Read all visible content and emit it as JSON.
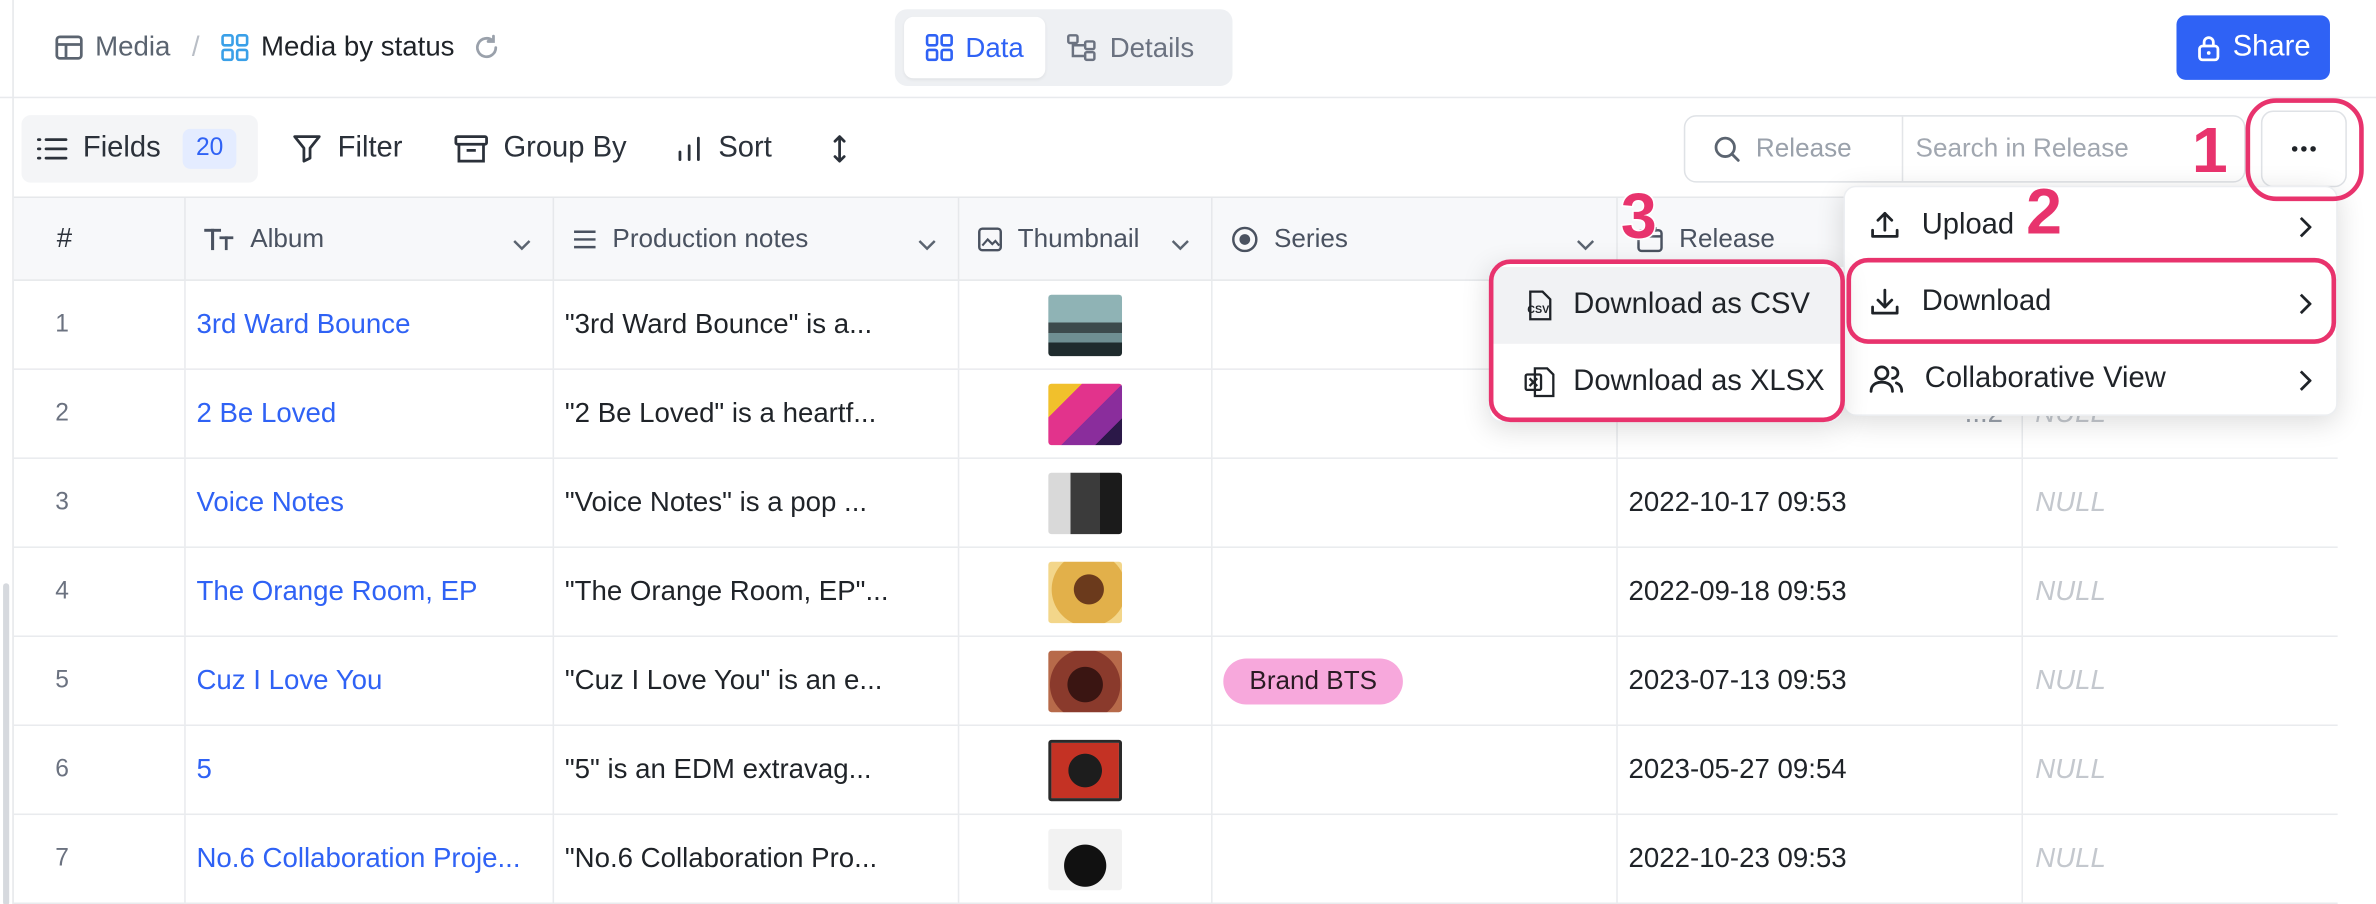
{
  "header": {
    "breadcrumb_root": "Media",
    "breadcrumb_separator": "/",
    "breadcrumb_current": "Media by status",
    "view_tabs": [
      {
        "label": "Data",
        "active": true
      },
      {
        "label": "Details",
        "active": false
      }
    ],
    "share_label": "Share"
  },
  "toolbar": {
    "fields_label": "Fields",
    "fields_count": "20",
    "filter_label": "Filter",
    "group_by_label": "Group By",
    "sort_label": "Sort",
    "search_field_label": "Release",
    "search_placeholder": "Search in Release"
  },
  "table": {
    "columns": [
      {
        "label": "#"
      },
      {
        "label": "Album",
        "icon": "text-type-icon"
      },
      {
        "label": "Production notes",
        "icon": "long-text-icon"
      },
      {
        "label": "Thumbnail",
        "icon": "image-icon"
      },
      {
        "label": "Series",
        "icon": "single-select-icon"
      },
      {
        "label": "Release",
        "icon": "calendar-icon"
      }
    ],
    "null_text": "NULL",
    "rows": [
      {
        "num": "1",
        "album": "3rd Ward Bounce",
        "notes": "\"3rd Ward Bounce\" is a...",
        "series": "",
        "release": "",
        "thumb_color": "#6c8a8e"
      },
      {
        "num": "2",
        "album": "2 Be Loved",
        "notes": "\"2 Be Loved\" is a heartf...",
        "series": "",
        "release": "",
        "thumb_color": "#d83f8a"
      },
      {
        "num": "3",
        "album": "Voice Notes",
        "notes": "\"Voice Notes\" is a pop ...",
        "series": "",
        "release": "2022-10-17 09:53",
        "thumb_color": "#3d3d3d"
      },
      {
        "num": "4",
        "album": "The Orange Room, EP",
        "notes": "\"The Orange Room, EP\"...",
        "series": "",
        "release": "2022-09-18 09:53",
        "thumb_color": "#d8a23a"
      },
      {
        "num": "5",
        "album": "Cuz I Love You",
        "notes": "\"Cuz I Love You\" is an e...",
        "series": "Brand BTS",
        "release": "2023-07-13 09:53",
        "thumb_color": "#7a2a26"
      },
      {
        "num": "6",
        "album": "5",
        "notes": "\"5\" is an EDM extravag...",
        "series": "",
        "release": "2023-05-27 09:54",
        "thumb_color": "#c43224"
      },
      {
        "num": "7",
        "album": "No.6 Collaboration Proje...",
        "notes": "\"No.6 Collaboration Pro...",
        "series": "",
        "release": "2022-10-23 09:53",
        "thumb_color": "#e9e9e9"
      }
    ],
    "hidden_release_fragment": "...2"
  },
  "more_menu": {
    "items": [
      {
        "label": "Upload",
        "icon": "upload-icon"
      },
      {
        "label": "Download",
        "icon": "download-icon"
      },
      {
        "label": "Collaborative View",
        "icon": "users-icon"
      }
    ]
  },
  "download_submenu": {
    "items": [
      {
        "label": "Download as CSV",
        "icon": "csv-file-icon"
      },
      {
        "label": "Download as XLSX",
        "icon": "xlsx-file-icon"
      }
    ]
  },
  "annotations": {
    "step1": "1",
    "step2": "2",
    "step3": "3",
    "color": "#e8336d"
  }
}
